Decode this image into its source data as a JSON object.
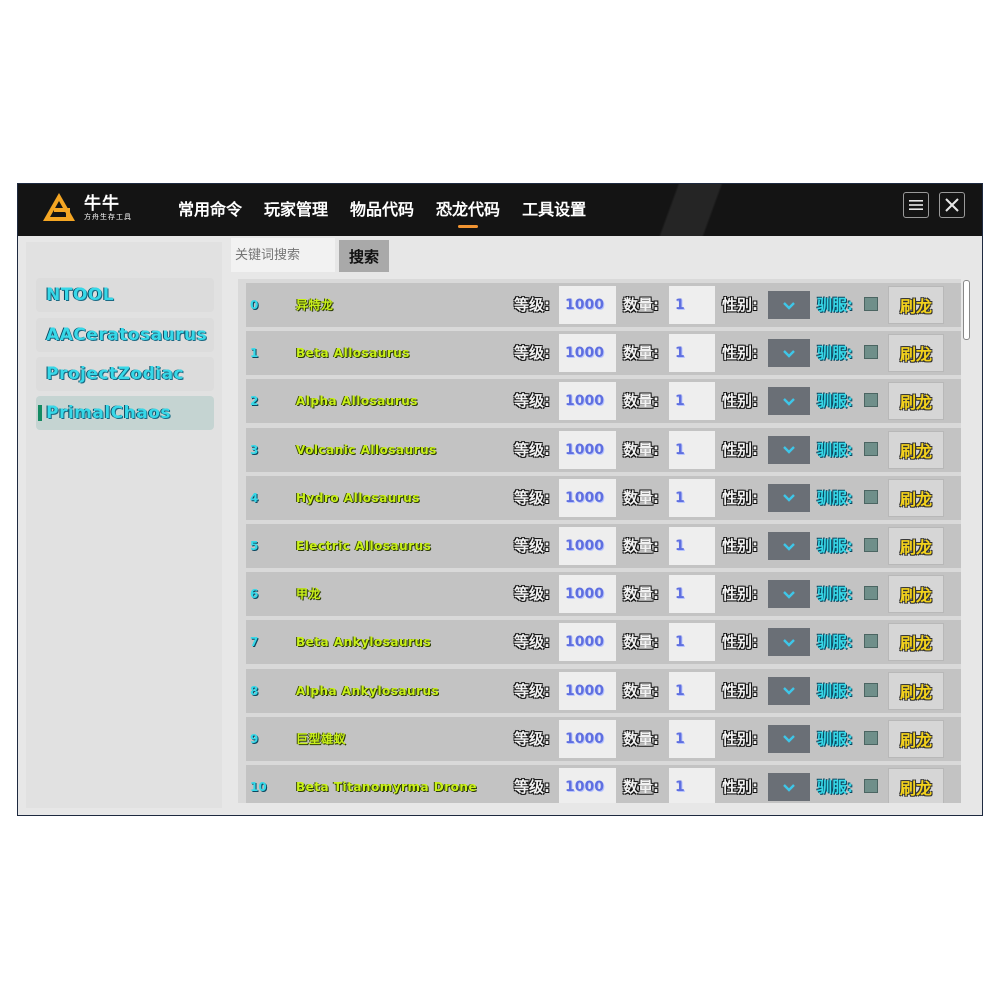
{
  "app": {
    "brand_name": "牛牛",
    "brand_sub": "方舟生存工具",
    "colors": {
      "titlebar": "#141414",
      "accent": "#f19432",
      "cyan_text": "#37d8e8",
      "lime_text": "#c9f01a",
      "yellow_button": "#f3d21c"
    }
  },
  "nav": {
    "items": [
      {
        "label": "常用命令"
      },
      {
        "label": "玩家管理"
      },
      {
        "label": "物品代码"
      },
      {
        "label": "恐龙代码",
        "active": true
      },
      {
        "label": "工具设置"
      }
    ]
  },
  "window_controls": {
    "menu_icon": "menu-icon",
    "close_icon": "close-icon"
  },
  "search": {
    "placeholder": "关键词搜索",
    "button_label": "搜索"
  },
  "sidebar": {
    "items": [
      {
        "label": "NTOOL"
      },
      {
        "label": "AACeratosaurus"
      },
      {
        "label": "ProjectZodiac"
      },
      {
        "label": "PrimalChaos",
        "active": true
      }
    ]
  },
  "row_labels": {
    "level": "等级:",
    "quantity": "数量:",
    "gender": "性别:",
    "tame": "驯服:",
    "spawn": "刷龙"
  },
  "dinos": [
    {
      "index": "0",
      "name": "异特龙",
      "level": "1000",
      "quantity": "1"
    },
    {
      "index": "1",
      "name": "Beta Allosaurus",
      "level": "1000",
      "quantity": "1"
    },
    {
      "index": "2",
      "name": "Alpha Allosaurus",
      "level": "1000",
      "quantity": "1"
    },
    {
      "index": "3",
      "name": "Volcanic Allosaurus",
      "level": "1000",
      "quantity": "1"
    },
    {
      "index": "4",
      "name": "Hydro Allosaurus",
      "level": "1000",
      "quantity": "1"
    },
    {
      "index": "5",
      "name": "Electric Allosaurus",
      "level": "1000",
      "quantity": "1"
    },
    {
      "index": "6",
      "name": "甲龙",
      "level": "1000",
      "quantity": "1"
    },
    {
      "index": "7",
      "name": "Beta Ankylosaurus",
      "level": "1000",
      "quantity": "1"
    },
    {
      "index": "8",
      "name": "Alpha Ankylosaurus",
      "level": "1000",
      "quantity": "1"
    },
    {
      "index": "9",
      "name": "巨型雄蚁",
      "level": "1000",
      "quantity": "1"
    },
    {
      "index": "10",
      "name": "Beta Titanomyrma Drone",
      "level": "1000",
      "quantity": "1"
    }
  ]
}
